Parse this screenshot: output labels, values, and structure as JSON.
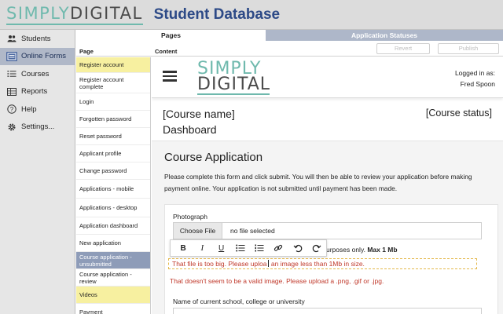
{
  "app": {
    "logo_part1": "SIMPLY",
    "logo_part2": "DIGITAL",
    "title": "Student Database"
  },
  "nav": {
    "items": [
      {
        "label": "Students",
        "icon": "students-icon"
      },
      {
        "label": "Online Forms",
        "icon": "forms-icon"
      },
      {
        "label": "Courses",
        "icon": "courses-icon"
      },
      {
        "label": "Reports",
        "icon": "reports-icon"
      },
      {
        "label": "Help",
        "icon": "help-icon"
      },
      {
        "label": "Settings...",
        "icon": "gear-icon"
      }
    ],
    "active_index": 1
  },
  "tabs": {
    "pages": "Pages",
    "application_statuses": "Application Statuses"
  },
  "columns": {
    "page": "Page",
    "content": "Content"
  },
  "actions": {
    "revert": "Revert",
    "publish": "Publish"
  },
  "pages": [
    {
      "label": "Register account",
      "highlight": "yellow"
    },
    {
      "label": "Register account complete",
      "highlight": ""
    },
    {
      "label": "Login",
      "highlight": ""
    },
    {
      "label": "Forgotten password",
      "highlight": ""
    },
    {
      "label": "Reset password",
      "highlight": ""
    },
    {
      "label": "Applicant profile",
      "highlight": ""
    },
    {
      "label": "Change password",
      "highlight": ""
    },
    {
      "label": "Applications - mobile",
      "highlight": ""
    },
    {
      "label": "Applications - desktop",
      "highlight": ""
    },
    {
      "label": "Application dashboard",
      "highlight": ""
    },
    {
      "label": "New application",
      "highlight": ""
    },
    {
      "label": "Course application - unsubmitted",
      "highlight": "blue"
    },
    {
      "label": "Course application - review",
      "highlight": ""
    },
    {
      "label": "Videos",
      "highlight": "yellow"
    },
    {
      "label": "Payment",
      "highlight": ""
    }
  ],
  "preview": {
    "logo_line1": "SIMPLY",
    "logo_line2": "DIGITAL",
    "logged_in_label": "Logged in as:",
    "user_name": "Fred Spoon",
    "course_name": "[Course name]",
    "dashboard": "Dashboard",
    "course_status": "[Course status]",
    "form_title": "Course Application",
    "form_intro": "Please complete this form and click submit. You will then be able to review your application before making payment online. Your application is not submitted until payment has been made.",
    "photo_label": "Photograph",
    "choose_file": "Choose File",
    "file_status": "no file selected",
    "help_prefix": "urposes only.",
    "help_bold": "Max 1 Mb",
    "error_1_a": "That file is too big. Please uploa",
    "error_1_b": " an image less than 1Mb in size.",
    "error_2": "That doesn't seem to be a valid image. Please upload a .png, .gif or .jpg.",
    "school_label": "Name of current school, college or university"
  },
  "toolbar": {
    "bold": "B",
    "italic": "I",
    "underline": "U",
    "bullets": "☰",
    "numbered": "☷",
    "link": "🔗",
    "undo": "↶",
    "redo": "↷"
  }
}
